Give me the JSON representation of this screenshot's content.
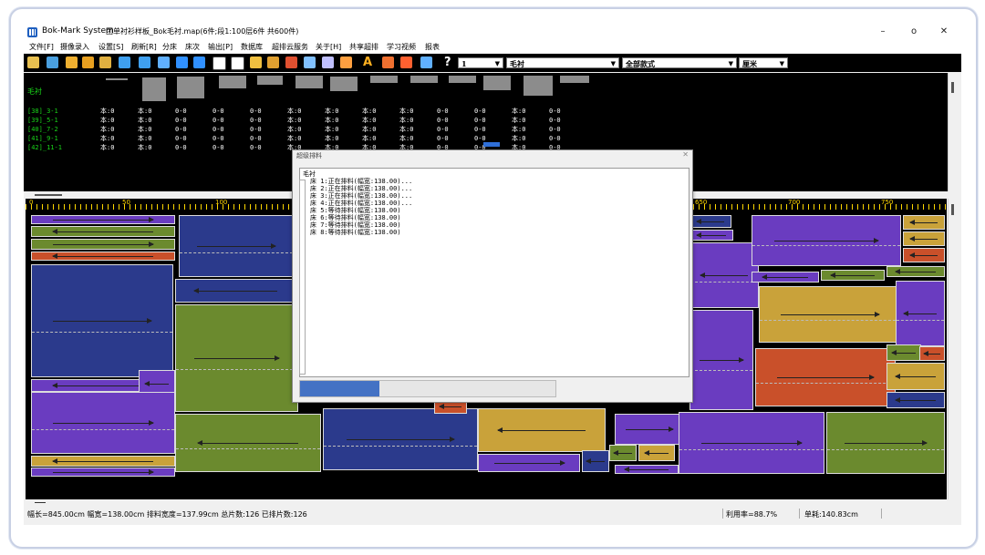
{
  "window": {
    "app_name": "Bok-Mark System",
    "document_title": "团单衬衫样板_Bok毛衬.map(6件;段1:100层6件 共600件)",
    "controls": {
      "minimize": "–",
      "maximize": "o",
      "close": "✕"
    }
  },
  "menu": [
    "文件[F]",
    "摄像录入",
    "设置[S]",
    "刷新[R]",
    "分床",
    "床次",
    "输出[P]",
    "数据库",
    "超排云服务",
    "关于[H]",
    "共享超排",
    "学习视频",
    "报表"
  ],
  "toolbar": {
    "help_glyph": "?",
    "selects": [
      {
        "value": "1"
      },
      {
        "value": "毛衬"
      },
      {
        "value": "全部款式"
      },
      {
        "value": "厘米"
      }
    ]
  },
  "pieces_panel": {
    "header": "毛衬",
    "rows": [
      {
        "name": "[38]_3-1",
        "cells": [
          "本:0",
          "本:0",
          "0-0",
          "0-0",
          "0-0",
          "本:0",
          "本:0",
          "本:0",
          "本:0",
          "0-0",
          "0-0",
          "本:0",
          "0-0"
        ]
      },
      {
        "name": "[39]_5-1",
        "cells": [
          "本:0",
          "本:0",
          "0-0",
          "0-0",
          "0-0",
          "本:0",
          "本:0",
          "本:0",
          "本:0",
          "0-0",
          "0-0",
          "本:0",
          "0-0"
        ]
      },
      {
        "name": "[40]_7-2",
        "cells": [
          "本:0",
          "本:0",
          "0-0",
          "0-0",
          "0-0",
          "本:0",
          "本:0",
          "本:0",
          "本:0",
          "0-0",
          "0-0",
          "本:0",
          "0-0"
        ]
      },
      {
        "name": "[41]_9-1",
        "cells": [
          "本:0",
          "本:0",
          "0-0",
          "0-0",
          "0-0",
          "本:0",
          "本:0",
          "本:0",
          "本:0",
          "0-0",
          "0-0",
          "本:0",
          "0-0"
        ]
      },
      {
        "name": "[42]_11-1",
        "cells": [
          "本:0",
          "本:0",
          "0-0",
          "0-0",
          "0-0",
          "本:0",
          "本:0",
          "本:0",
          "本:0",
          "0-0",
          "0-0",
          "本:0",
          "0-0"
        ]
      }
    ]
  },
  "ruler": {
    "labels": [
      "0",
      "50",
      "100",
      "650",
      "700",
      "750"
    ]
  },
  "dialog": {
    "title": "超级排料",
    "close": "✕",
    "header": "毛衬",
    "lines": [
      "床 1:正在排料(幅宽:138.00)...",
      "床 2:正在排料(幅宽:138.00)...",
      "床 3:正在排料(幅宽:138.00)...",
      "床 4:正在排料(幅宽:138.00)...",
      "床 5:等待排料(幅宽:138.00)",
      "床 6:等待排料(幅宽:138.00)",
      "床 7:等待排料(幅宽:138.00)",
      "床 8:等待排料(幅宽:138.00)"
    ],
    "progress": 0.31
  },
  "status": {
    "left": "幅长=845.00cm 幅宽=138.00cm 排料宽度=137.99cm 总片数:126 已排片数:126",
    "utilization": "利用率=88.7%",
    "single": "单耗:140.83cm"
  },
  "colors": {
    "navy": "#2b3a8c",
    "purple": "#6a3cc0",
    "olive": "#6b8a2e",
    "mustard": "#c9a23a",
    "rust": "#c9502a",
    "green_text": "#19d319",
    "ruler": "#ffd700",
    "progress": "#4472c4"
  }
}
